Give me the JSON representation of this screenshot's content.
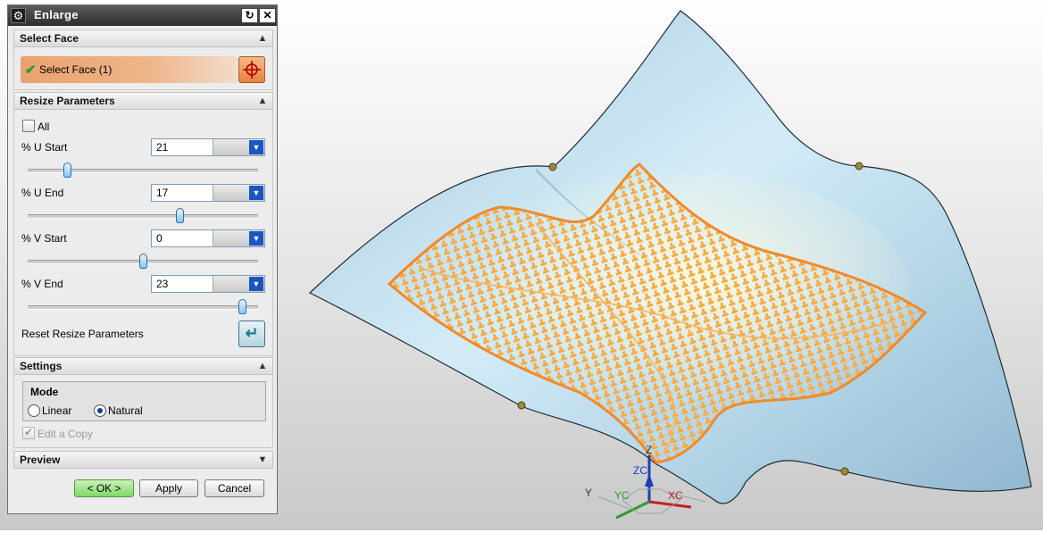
{
  "dialog": {
    "title": "Enlarge",
    "reset_icon": "↻",
    "close_icon": "✕",
    "select_face": {
      "header": "Select Face",
      "label": "Select Face (1)"
    },
    "resize": {
      "header": "Resize Parameters",
      "all_label": "All",
      "u_start_label": "% U Start",
      "u_start_value": "21",
      "u_start_slider": 0.17,
      "u_end_label": "% U End",
      "u_end_value": "17",
      "u_end_slider": 0.66,
      "v_start_label": "% V Start",
      "v_start_value": "0",
      "v_start_slider": 0.5,
      "v_end_label": "% V End",
      "v_end_value": "23",
      "v_end_slider": 0.93,
      "reset_label": "Reset Resize Parameters"
    },
    "settings": {
      "header": "Settings",
      "mode_label": "Mode",
      "linear_label": "Linear",
      "natural_label": "Natural",
      "selected_mode": "Natural",
      "edit_copy_label": "Edit a Copy"
    },
    "preview": {
      "header": "Preview"
    },
    "buttons": {
      "ok": "< OK >",
      "apply": "Apply",
      "cancel": "Cancel"
    }
  },
  "triad": {
    "z": "Z",
    "zc": "ZC",
    "y": "Y",
    "yc": "YC",
    "xc": "XC"
  },
  "colors": {
    "surface": "#bcd9e8",
    "highlight": "#f4a94e",
    "accent_orange": "#e8823f",
    "ok_green": "#7fd86a"
  }
}
